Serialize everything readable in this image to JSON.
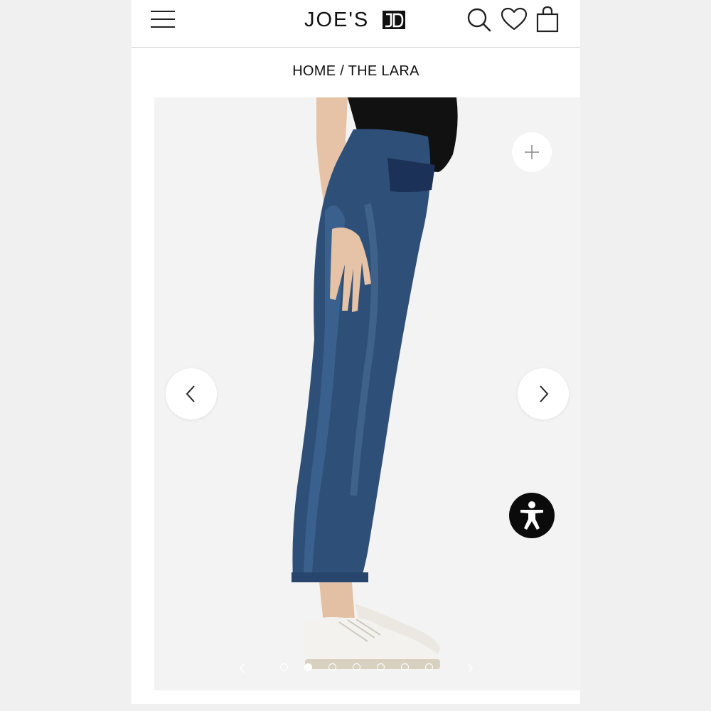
{
  "header": {
    "logo_text": "JOE'S",
    "logo_mark": "JD",
    "icons": [
      "menu-icon",
      "search-icon",
      "heart-icon",
      "bag-icon"
    ]
  },
  "breadcrumb": {
    "home": "HOME",
    "separator": "/",
    "current": "THE LARA"
  },
  "gallery": {
    "active_index": 1,
    "total_slides": 7,
    "controls": [
      "chevron-left-icon",
      "chevron-right-icon",
      "plus-icon",
      "accessibility-icon"
    ]
  },
  "colors": {
    "background": "#f0f0f0",
    "page": "#ffffff",
    "image_bg": "#f3f3f3",
    "denim": "#2e4f78",
    "accessibility_button": "#0b0b0b"
  }
}
